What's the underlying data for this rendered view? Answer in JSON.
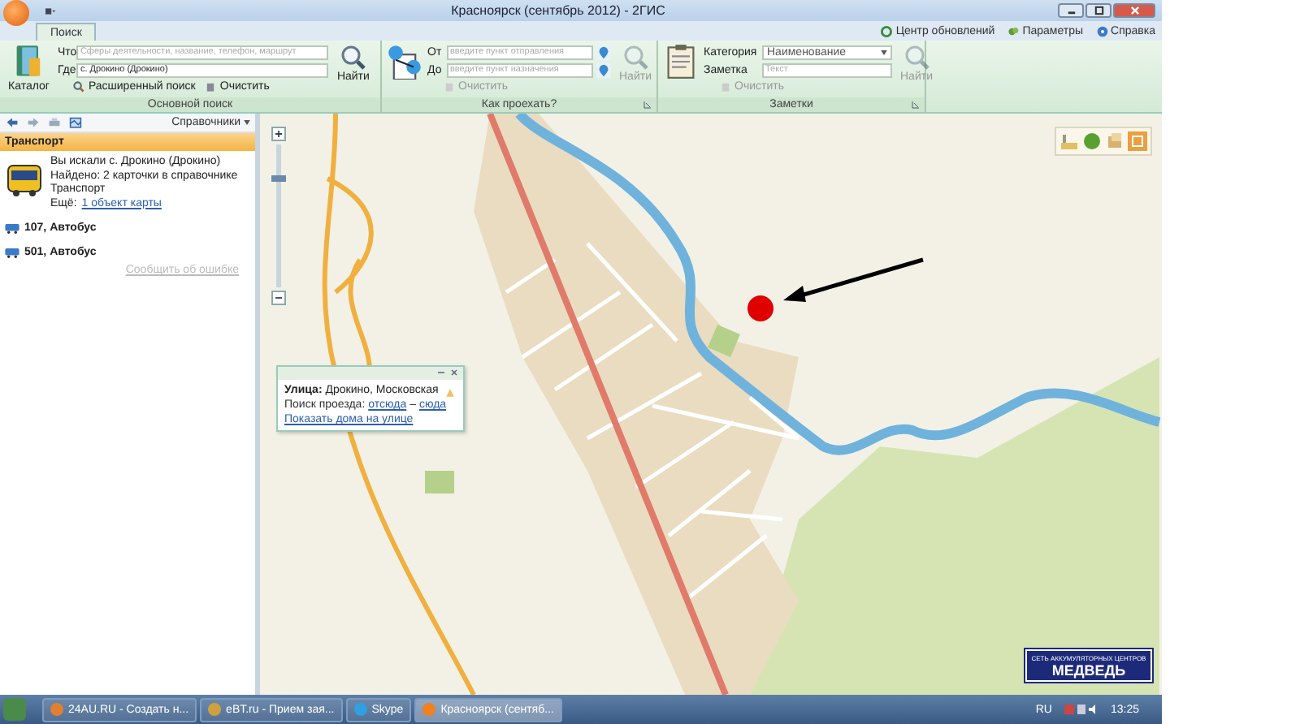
{
  "window": {
    "title": "Красноярск (сентябрь 2012) - 2ГИС"
  },
  "tabs": [
    {
      "label": "Поиск",
      "selected": true
    }
  ],
  "top_links": [
    "Центр обновлений",
    "Параметры",
    "Справка"
  ],
  "ribbon": [
    {
      "kind": "search",
      "title": "Основной поиск",
      "big_button": "Каталог",
      "fields": [
        {
          "kind": "text",
          "label": "Что",
          "placeholder": "Сферы деятельности, название, телефон, маршрут"
        },
        {
          "kind": "text",
          "label": "Где",
          "value": "с. Дрокино (Дрокино)"
        }
      ],
      "actions": [
        {
          "label": "Расширенный поиск",
          "disabled": false
        },
        {
          "label": "Очистить",
          "disabled": false
        }
      ],
      "find": {
        "label": "Найти",
        "disabled": false
      }
    },
    {
      "kind": "route",
      "title": "Как проехать?",
      "fields": [
        {
          "kind": "pin",
          "label": "От",
          "placeholder": "введите пункт отправления"
        },
        {
          "kind": "pin",
          "label": "До",
          "placeholder": "введите пункт назначения"
        }
      ],
      "actions": [
        {
          "label": "Очистить",
          "disabled": true
        }
      ],
      "find": {
        "label": "Найти",
        "disabled": true
      }
    },
    {
      "kind": "notes",
      "title": "Заметки",
      "fields": [
        {
          "kind": "select",
          "label": "Категория",
          "value": "Наименование"
        },
        {
          "kind": "text",
          "label": "Заметка",
          "placeholder": "Текст"
        }
      ],
      "actions": [
        {
          "label": "Очистить",
          "disabled": true
        }
      ],
      "find": {
        "label": "Найти",
        "disabled": true
      }
    }
  ],
  "panel": {
    "toolbar_menu": "Справочники",
    "header": "Транспорт",
    "result": {
      "lines": [
        "Вы искали с. Дрокино (Дрокино)",
        "Найдено: 2 карточки в справочнике",
        "Транспорт"
      ],
      "more_label": "Ещё:",
      "more_link": "1 объект карты"
    },
    "items": [
      "107, Автобус",
      "501, Автобус"
    ],
    "report_link": "Сообщить об ошибке"
  },
  "map": {
    "zoom_slider": {
      "level": 0.78
    },
    "popup": {
      "title_line": "**Улица:** Дрокино, Московская",
      "route_label": "Поиск проезда:",
      "from_link": "отсюда",
      "separator": "–",
      "to_link": "сюда",
      "houses_link": "Показать дома на улице"
    },
    "banner": {
      "line1": "СЕТЬ АККУМУЛЯТОРНЫХ ЦЕНТРОВ",
      "line2": "МЕДВЕДЬ"
    }
  },
  "taskbar": {
    "items": [
      {
        "label": "24AU.RU - Создать н...",
        "selected": false
      },
      {
        "label": "eBT.ru - Прием зая...",
        "selected": false
      },
      {
        "label": "Skype",
        "selected": false
      },
      {
        "label": "Красноярск (сентяб...",
        "selected": true
      }
    ],
    "language": "RU",
    "clock": "13:25"
  }
}
